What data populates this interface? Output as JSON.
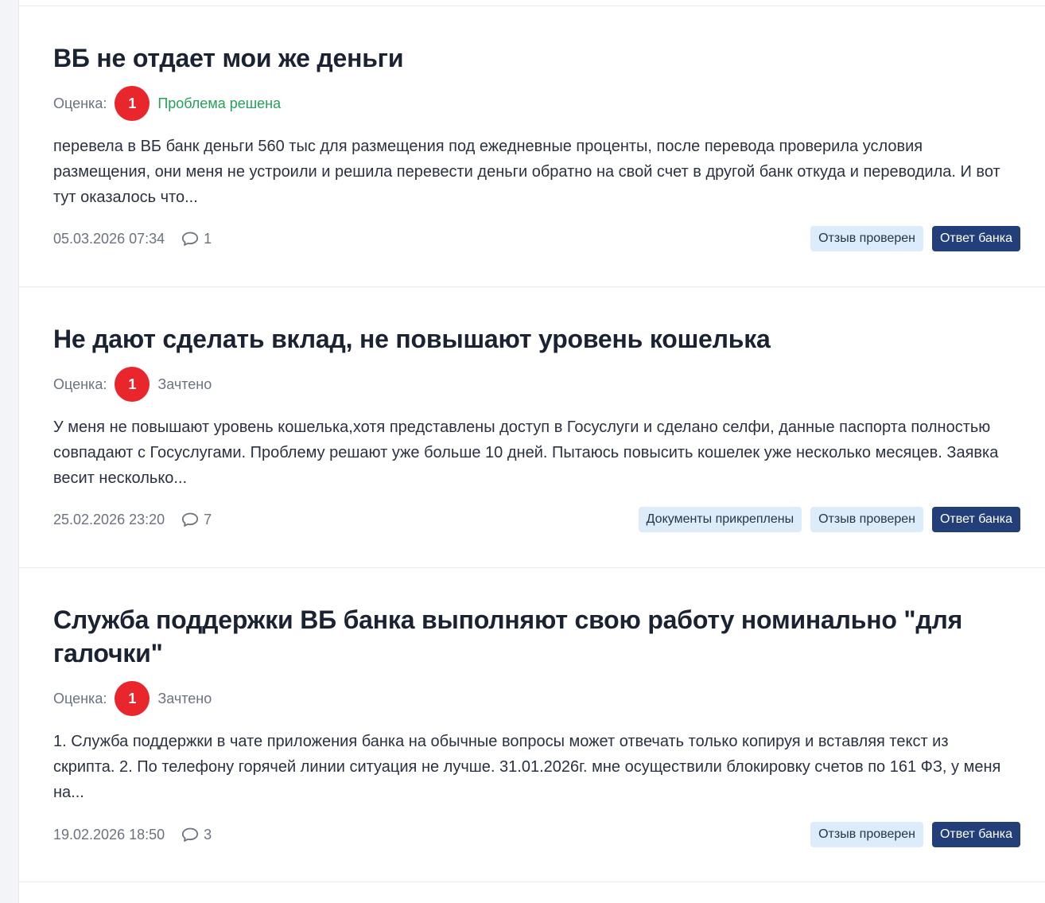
{
  "reviews": [
    {
      "title": "ВБ не отдает мои же деньги",
      "rating_label": "Оценка:",
      "rating": "1",
      "status": "Проблема решена",
      "status_color": "#27a05a",
      "excerpt": "перевела в ВБ банк деньги 560 тыс для размещения под ежедневные проценты, после перевода проверила условия размещения, они меня не устроили и решила перевести деньги обратно на свой счет в другой банк откуда и переводила. И вот тут оказалось что...",
      "date": "05.03.2026 07:34",
      "comments": "1",
      "tags": [
        "Отзыв проверен",
        "Ответ банка"
      ]
    },
    {
      "title": "Не дают сделать вклад, не повышают уровень кошелька",
      "rating_label": "Оценка:",
      "rating": "1",
      "status": "Зачтено",
      "excerpt": "У меня не повышают уровень кошелька,хотя представлены доступ в Госуслуги и сделано селфи, данные паспорта полностью совпадают с Госуслугами. Проблему решают уже больше 10 дней. Пытаюсь повысить кошелек уже несколько месяцев. Заявка весит несколько...",
      "date": "25.02.2026 23:20",
      "comments": "7",
      "tags": [
        "Документы прикреплены",
        "Отзыв проверен",
        "Ответ банка"
      ]
    },
    {
      "title": "Служба поддержки ВБ банка выполняют свою работу номинально \"для галочки\"",
      "rating_label": "Оценка:",
      "rating": "1",
      "status": "Зачтено",
      "excerpt": "1. Служба поддержки в чате приложения банка на обычные вопросы может отвечать только копируя и вставляя текст из скрипта. 2. По телефону горячей линии ситуация не лучше. 31.01.2026г. мне осуществили блокировку счетов по 161 ФЗ, у меня на...",
      "date": "19.02.2026 18:50",
      "comments": "3",
      "tags": [
        "Отзыв проверен",
        "Ответ банка"
      ]
    }
  ],
  "colors": {
    "rating_badge": "#e8262b",
    "tag_light_bg": "#dcecfb",
    "tag_dark_bg": "#223f7a",
    "status_default": "#6b7280"
  },
  "icons": {
    "comment": "speech-bubble-outline"
  }
}
